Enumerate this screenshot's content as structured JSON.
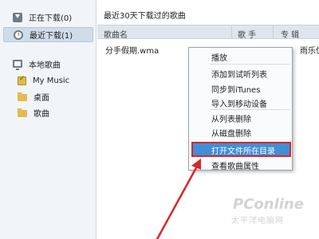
{
  "sidebar": {
    "items": [
      {
        "label": "正在下载(0)",
        "icon": "download-icon"
      },
      {
        "label": "最近下载(1)",
        "icon": "clock-icon",
        "selected": true
      },
      {
        "label": "本地歌曲",
        "icon": "monitor-icon"
      },
      {
        "label": "My Music",
        "icon": "check-icon"
      },
      {
        "label": "桌面",
        "icon": "folder-icon"
      },
      {
        "label": "歌曲",
        "icon": "folder-icon"
      }
    ]
  },
  "main": {
    "title": "最近30天下载过的歌曲",
    "columns": [
      "歌曲名",
      "歌 手",
      "专 辑"
    ],
    "rows": [
      {
        "name": "分手假期.wma",
        "album_partial": "雨乐仿小室"
      }
    ]
  },
  "context_menu": {
    "items": [
      "播放",
      "添加到试听列表",
      "同步到iTunes",
      "导入到移动设备",
      "从列表删除",
      "从磁盘删除",
      "打开文件所在目录",
      "查看歌曲属性"
    ],
    "highlighted": "打开文件所在目录"
  },
  "watermark": {
    "logo": "PConline",
    "sub": "太平洋电脑网"
  },
  "colors": {
    "sidebar_bg": "#f2f5f8",
    "selected_bg": "#cfdcea",
    "header_bg": "#dde6ef",
    "menu_highlight": "#3f8fd9",
    "annotation_red": "#d9262a"
  }
}
